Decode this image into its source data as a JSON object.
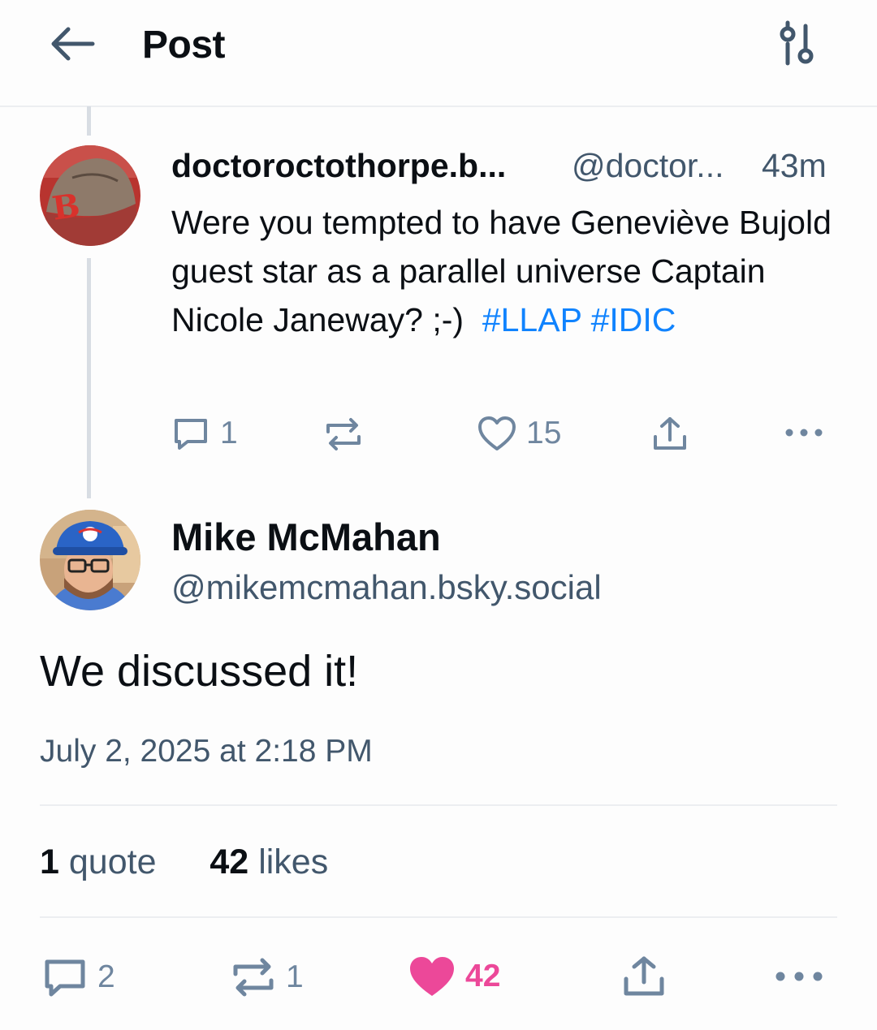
{
  "header": {
    "title": "Post"
  },
  "parent_post": {
    "author_name": "doctoroctothorpe.b...",
    "handle": "@doctor...",
    "time": "43m",
    "text": "Were you tempted to have Geneviève Bujold guest star as a parallel universe Captain Nicole Janeway?  ;-)",
    "hashtags": [
      "#LLAP",
      "#IDIC"
    ],
    "replies": "1",
    "likes": "15"
  },
  "main_post": {
    "author_name": "Mike McMahan",
    "handle": "@mikemcmahan.bsky.social",
    "text": "We discussed it!",
    "timestamp": "July 2, 2025 at 2:18 PM",
    "stats": {
      "quotes": "1",
      "quotes_label": "quote",
      "likes": "42",
      "likes_label": "likes"
    },
    "actions": {
      "replies": "2",
      "reposts": "1",
      "likes": "42"
    }
  },
  "colors": {
    "accent": "#1083fe",
    "like_active": "#ec4899",
    "muted": "#6f869f",
    "text_secondary": "#42576c"
  }
}
